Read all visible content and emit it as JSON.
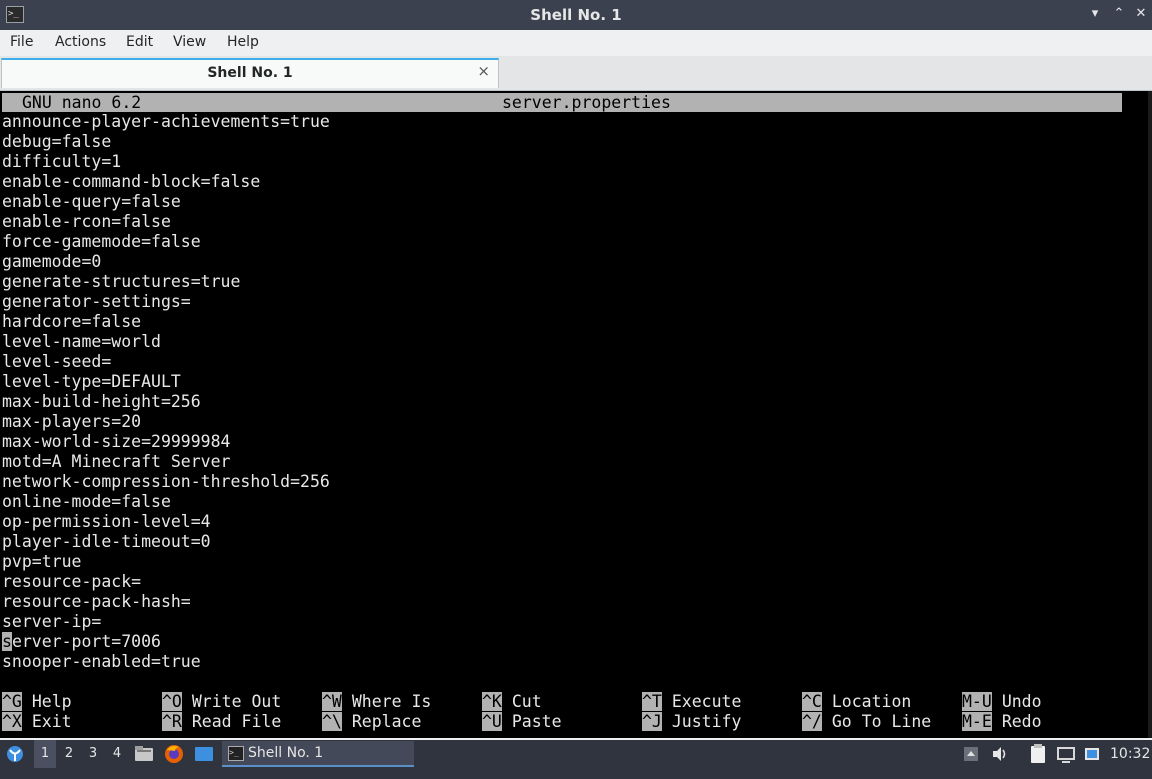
{
  "window": {
    "title": "Shell No. 1",
    "controls": [
      "▾",
      "⌃",
      "✕"
    ]
  },
  "menubar": [
    "File",
    "Actions",
    "Edit",
    "View",
    "Help"
  ],
  "tab": {
    "label": "Shell No. 1",
    "close": "×"
  },
  "nano": {
    "version": "GNU nano 6.2",
    "filename": "server.properties",
    "lines": [
      "announce-player-achievements=true",
      "debug=false",
      "difficulty=1",
      "enable-command-block=false",
      "enable-query=false",
      "enable-rcon=false",
      "force-gamemode=false",
      "gamemode=0",
      "generate-structures=true",
      "generator-settings=",
      "hardcore=false",
      "level-name=world",
      "level-seed=",
      "level-type=DEFAULT",
      "max-build-height=256",
      "max-players=20",
      "max-world-size=29999984",
      "motd=A Minecraft Server",
      "network-compression-threshold=256",
      "online-mode=false",
      "op-permission-level=4",
      "player-idle-timeout=0",
      "pvp=true",
      "resource-pack=",
      "resource-pack-hash=",
      "server-ip=",
      "server-port=7006",
      "snooper-enabled=true"
    ],
    "cursor_line": 26,
    "shortcuts": [
      {
        "key": "^G",
        "label": "Help"
      },
      {
        "key": "^X",
        "label": "Exit"
      },
      {
        "key": "^O",
        "label": "Write Out"
      },
      {
        "key": "^R",
        "label": "Read File"
      },
      {
        "key": "^W",
        "label": "Where Is"
      },
      {
        "key": "^\\",
        "label": "Replace"
      },
      {
        "key": "^K",
        "label": "Cut"
      },
      {
        "key": "^U",
        "label": "Paste"
      },
      {
        "key": "^T",
        "label": "Execute"
      },
      {
        "key": "^J",
        "label": "Justify"
      },
      {
        "key": "^C",
        "label": "Location"
      },
      {
        "key": "^/",
        "label": "Go To Line"
      },
      {
        "key": "M-U",
        "label": "Undo"
      },
      {
        "key": "M-E",
        "label": "Redo"
      }
    ]
  },
  "taskbar": {
    "desktops": [
      "1",
      "2",
      "3",
      "4"
    ],
    "active_desktop": "1",
    "task_label": "Shell No. 1",
    "clock": "10:32",
    "launchers": [
      "file-manager-icon",
      "firefox-icon",
      "desktop-icon"
    ],
    "tray": [
      "tray-arrow-icon",
      "volume-icon",
      "clipboard-icon",
      "network-icon",
      "bluetooth-icon"
    ]
  }
}
